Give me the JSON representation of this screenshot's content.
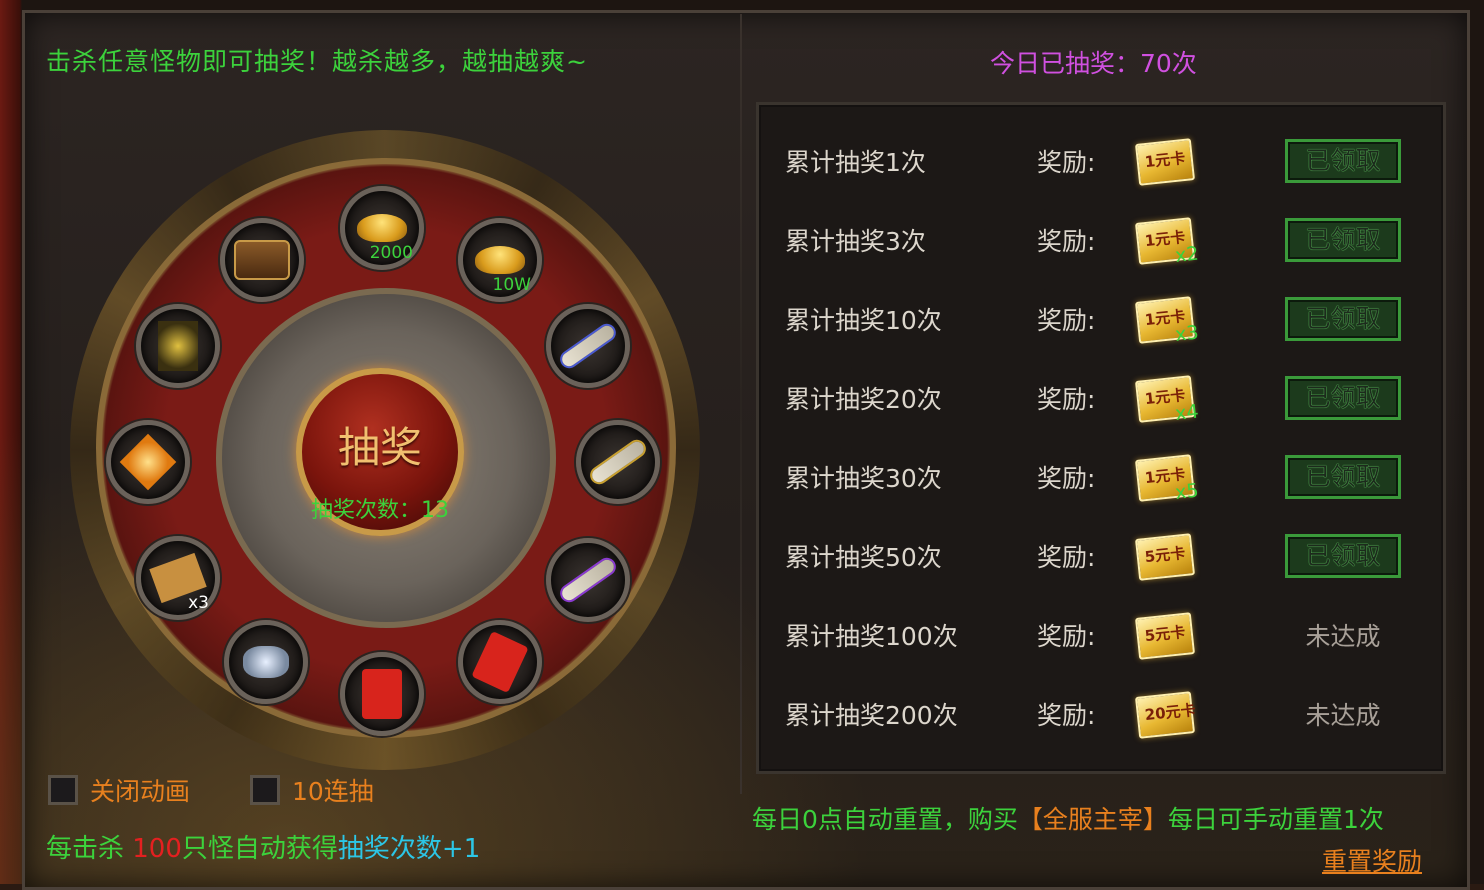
{
  "header": {
    "hint": "击杀任意怪物即可抽奖！越杀越多，越抽越爽~",
    "today_label": "今日已抽奖：70次"
  },
  "wheel": {
    "spin_label": "抽奖",
    "count_label": "抽奖次数：13",
    "slots": [
      {
        "icon": "gold-ingot-icon",
        "qty": "2000"
      },
      {
        "icon": "gold-ingot-icon",
        "qty": "10W"
      },
      {
        "icon": "scroll-icon",
        "qty": ""
      },
      {
        "icon": "scroll-icon",
        "qty": ""
      },
      {
        "icon": "scroll-icon",
        "qty": ""
      },
      {
        "icon": "red-packet-icon",
        "qty": ""
      },
      {
        "icon": "red-packet-icon",
        "qty": ""
      },
      {
        "icon": "crystal-icon",
        "qty": ""
      },
      {
        "icon": "paper-icon",
        "qty": "x3"
      },
      {
        "icon": "gem-icon",
        "qty": ""
      },
      {
        "icon": "book-icon",
        "qty": ""
      },
      {
        "icon": "treasure-chest-icon",
        "qty": ""
      }
    ]
  },
  "options": {
    "close_anim": "关闭动画",
    "ten_draw": "10连抽"
  },
  "kill_hint": {
    "prefix": "每击杀 ",
    "num": "100",
    "mid": "只怪自动获得",
    "target": "抽奖次数+1"
  },
  "rewards": {
    "reward_label": "奖励:",
    "rows": [
      {
        "name": "累计抽奖1次",
        "card": "1元卡",
        "mult": "",
        "status": "已领取",
        "claimed": true
      },
      {
        "name": "累计抽奖3次",
        "card": "1元卡",
        "mult": "x2",
        "status": "已领取",
        "claimed": true
      },
      {
        "name": "累计抽奖10次",
        "card": "1元卡",
        "mult": "x3",
        "status": "已领取",
        "claimed": true
      },
      {
        "name": "累计抽奖20次",
        "card": "1元卡",
        "mult": "x4",
        "status": "已领取",
        "claimed": true
      },
      {
        "name": "累计抽奖30次",
        "card": "1元卡",
        "mult": "x5",
        "status": "已领取",
        "claimed": true
      },
      {
        "name": "累计抽奖50次",
        "card": "5元卡",
        "mult": "",
        "status": "已领取",
        "claimed": true
      },
      {
        "name": "累计抽奖100次",
        "card": "5元卡",
        "mult": "",
        "status": "未达成",
        "claimed": false
      },
      {
        "name": "累计抽奖200次",
        "card": "20元卡",
        "mult": "",
        "status": "未达成",
        "claimed": false
      }
    ]
  },
  "reset": {
    "note_prefix": "每日0点自动重置，购买",
    "note_highlight": "【全服主宰】",
    "note_suffix": "每日可手动重置1次",
    "button": "重置奖励"
  }
}
